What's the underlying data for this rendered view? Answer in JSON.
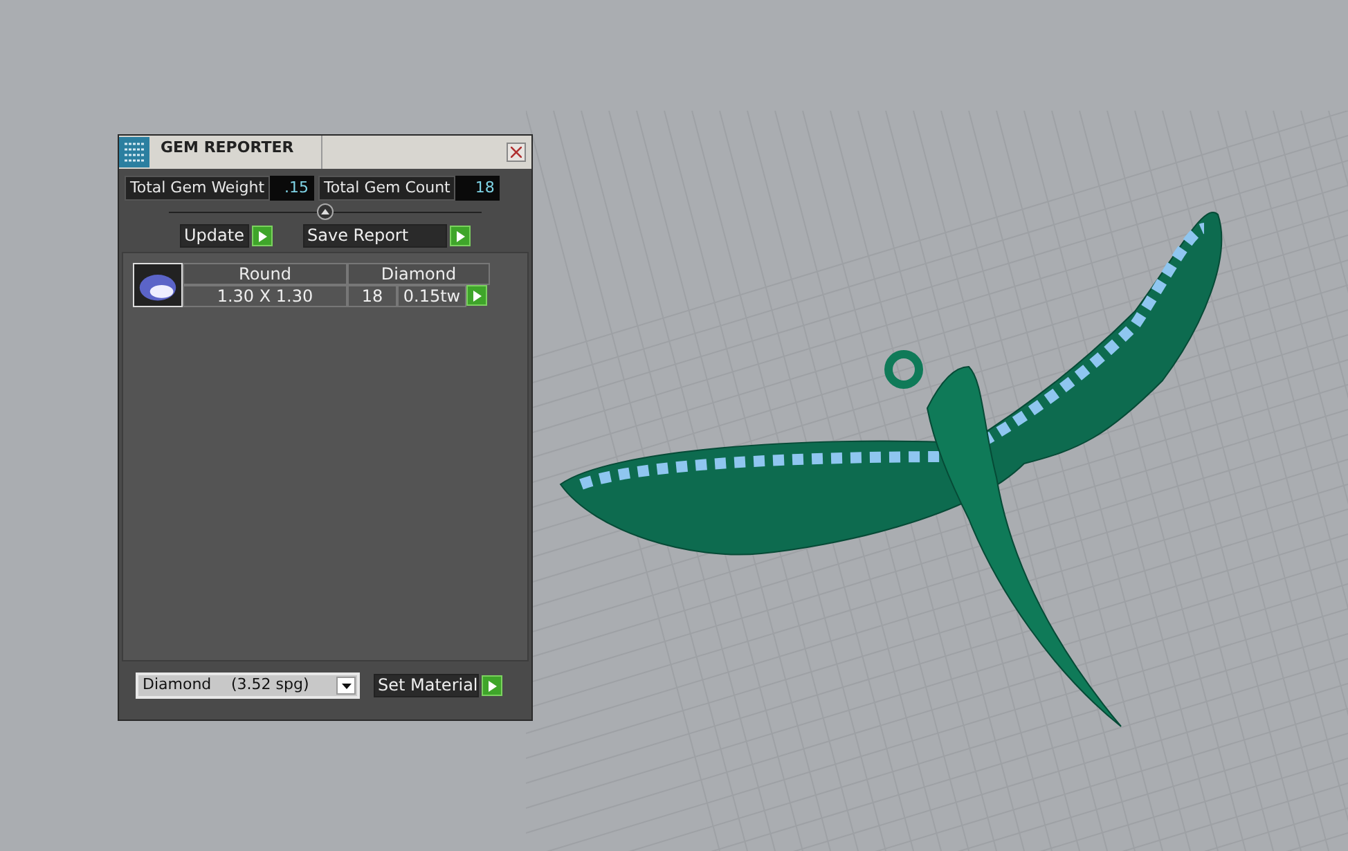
{
  "window": {
    "title": "GEM REPORTER"
  },
  "totals": [
    {
      "label": "Total Gem Weight",
      "value": ".15"
    },
    {
      "label": "Total Gem Count",
      "value": "18"
    }
  ],
  "actions": [
    "Update",
    "Save Report"
  ],
  "gems": [
    {
      "shape": "Round",
      "size": "1.30 X 1.30",
      "material": "Diamond",
      "count": "18",
      "weight": "0.15tw"
    }
  ],
  "material_select": {
    "value": "Diamond",
    "density": "(3.52 spg)"
  },
  "set_button": "Set Material"
}
